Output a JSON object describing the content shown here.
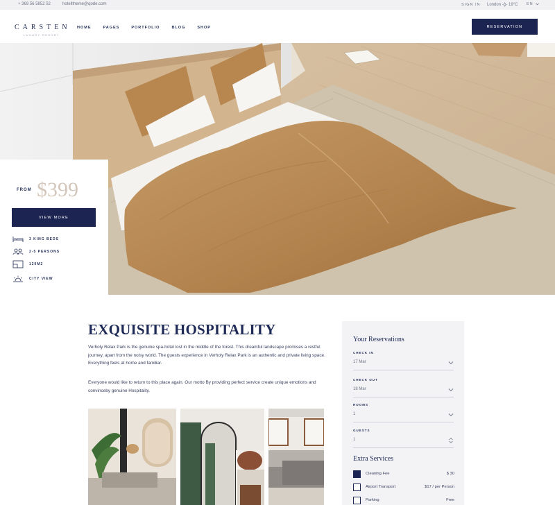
{
  "topbar": {
    "phone": "+ 369 56 5852 52",
    "email": "hotelltheme@qode.com",
    "signin": "SIGN IN",
    "weather_city": "London",
    "weather_temp": "19°C",
    "lang": "EN",
    "weather_icon": "sun-icon"
  },
  "header": {
    "logo_name": "CARSTEN",
    "logo_tag": "LUXURY RESORT",
    "nav": [
      "HOME",
      "PAGES",
      "PORTFOLIO",
      "BLOG",
      "SHOP"
    ],
    "reservation_label": "RESERVATION"
  },
  "card": {
    "from_label": "FROM",
    "price": "$399",
    "view_more": "VIEW MORE",
    "features": [
      {
        "icon": "bed-icon",
        "label": "3 KING BEDS"
      },
      {
        "icon": "persons-icon",
        "label": "2-5 PERSONS"
      },
      {
        "icon": "area-icon",
        "label": "120M2"
      },
      {
        "icon": "sun-view-icon",
        "label": "CITY VIEW"
      }
    ]
  },
  "content": {
    "heading": "EXQUISITE HOSPITALITY",
    "para1": "Verholy Relax Park is the genuine spa-hotel lost in the middle of the forest. This dreamful landscape promises a restful journey, apart from the noisy world. The guests experience in Verholy Relax Park is an authentic and private living space. Everything feels at home and familiar.",
    "para2": "Everyone would like to return to this place again. Our motto By providing perfect service create unique emotions and convinceby genuine Hospitality."
  },
  "reservations": {
    "title": "Your Reservations",
    "fields": [
      {
        "label": "CHECK IN",
        "value": "17 Mar"
      },
      {
        "label": "CHECK OUT",
        "value": "18 Mar"
      },
      {
        "label": "ROOMS",
        "value": "1"
      },
      {
        "label": "GUESTS",
        "value": "1"
      }
    ],
    "extra_title": "Extra Services",
    "services": [
      {
        "name": "Cleaning Fee",
        "price": "$ 30",
        "checked": true
      },
      {
        "name": "Airport Transport",
        "price": "$17 / per Person",
        "checked": false
      },
      {
        "name": "Parking",
        "price": "Free",
        "checked": false
      }
    ]
  },
  "colors": {
    "navy": "#1c2552",
    "price": "#d3c6bb",
    "panel": "#f3f3f5"
  }
}
